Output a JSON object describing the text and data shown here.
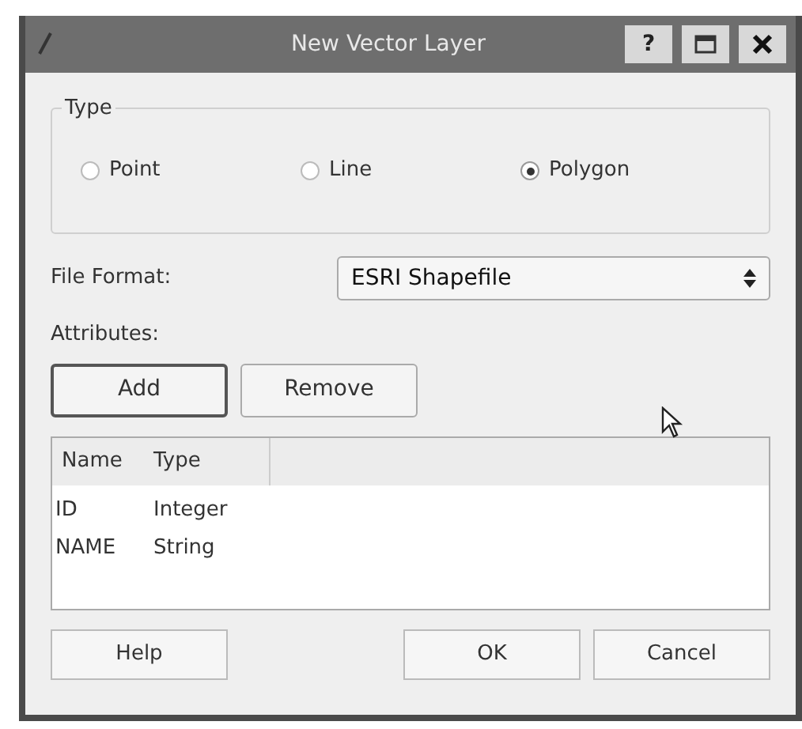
{
  "window": {
    "title": "New Vector Layer",
    "title_buttons": [
      "?"
    ]
  },
  "type_group": {
    "title": "Type",
    "options": [
      {
        "label": "Point",
        "selected": false
      },
      {
        "label": "Line",
        "selected": false
      },
      {
        "label": "Polygon",
        "selected": true
      }
    ]
  },
  "file_format": {
    "label": "File Format:",
    "value": "ESRI Shapefile"
  },
  "attributes": {
    "label": "Attributes:",
    "buttons": [
      {
        "label": "Add",
        "focused": true
      },
      {
        "label": "Remove",
        "focused": false
      }
    ],
    "columns": [
      "Name",
      "Type"
    ],
    "rows": [
      [
        "ID",
        "Integer"
      ],
      [
        "NAME",
        "String"
      ]
    ]
  },
  "buttons": {
    "left": [
      "Help"
    ],
    "right": [
      "OK",
      "Cancel"
    ]
  }
}
